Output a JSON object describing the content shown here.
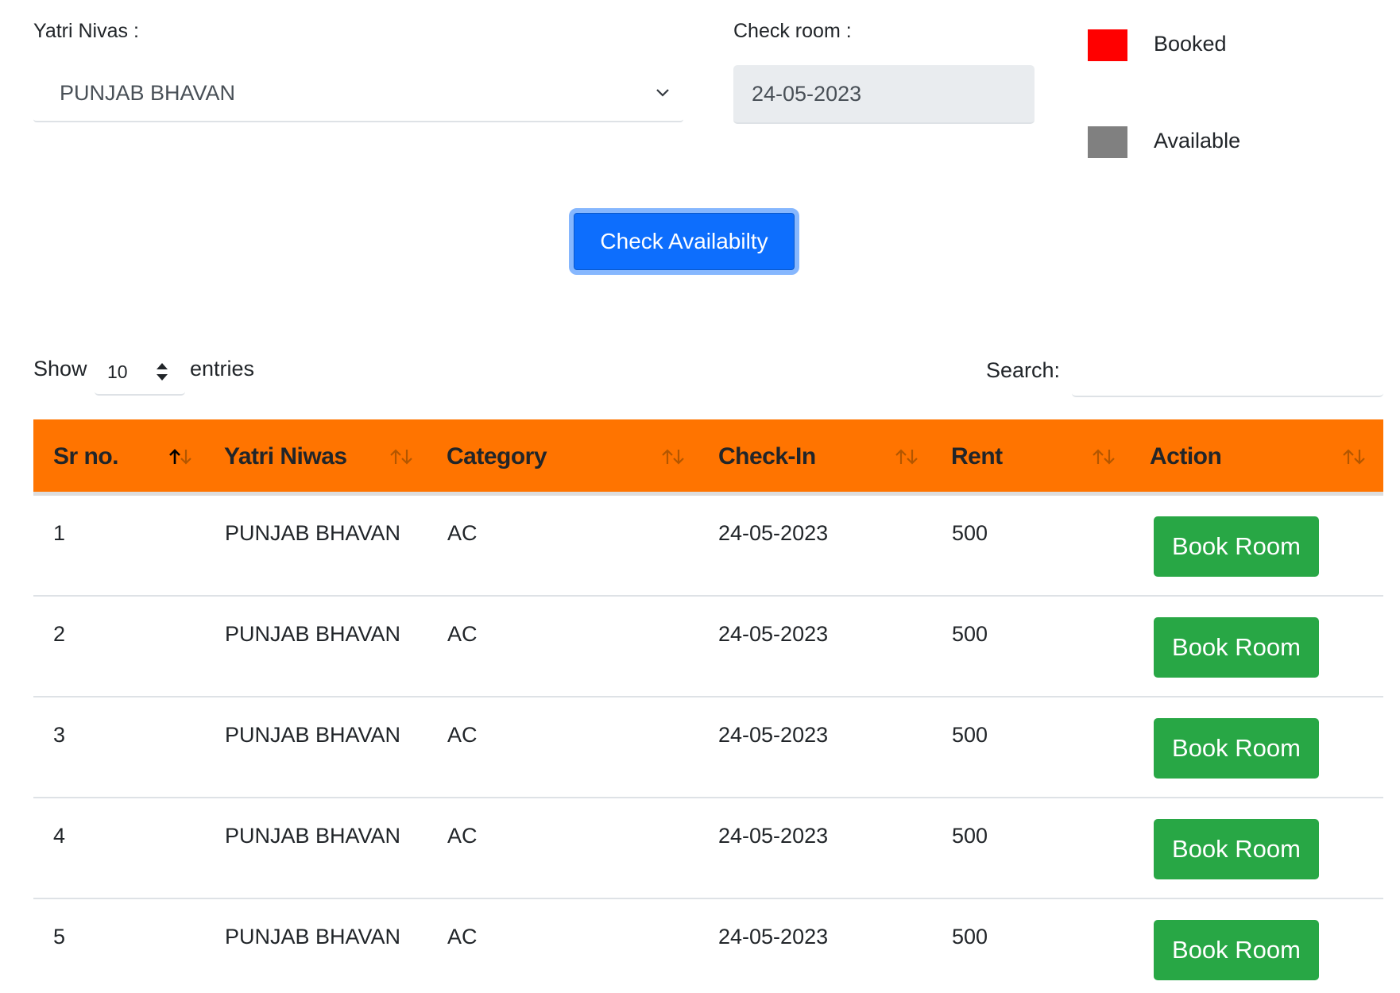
{
  "filters": {
    "yatri_nivas_label": "Yatri Nivas :",
    "yatri_nivas_value": "PUNJAB BHAVAN",
    "check_room_label": "Check room :",
    "check_room_value": "24-05-2023"
  },
  "legend": {
    "booked_label": "Booked",
    "booked_color": "#ff0000",
    "available_label": "Available",
    "available_color": "#808080"
  },
  "check_button_label": "Check Availabilty",
  "table_controls": {
    "show_label": "Show",
    "entries_value": "10",
    "entries_label": "entries",
    "search_label": "Search:",
    "search_value": ""
  },
  "table": {
    "header_color": "#ff7400",
    "columns": [
      "Sr no.",
      "Yatri Niwas",
      "Category",
      "Check-In",
      "Rent",
      "Action"
    ],
    "rows": [
      {
        "sr": "1",
        "niwas": "PUNJAB BHAVAN",
        "category": "AC",
        "checkin": "24-05-2023",
        "rent": "500",
        "action": "Book Room"
      },
      {
        "sr": "2",
        "niwas": "PUNJAB BHAVAN",
        "category": "AC",
        "checkin": "24-05-2023",
        "rent": "500",
        "action": "Book Room"
      },
      {
        "sr": "3",
        "niwas": "PUNJAB BHAVAN",
        "category": "AC",
        "checkin": "24-05-2023",
        "rent": "500",
        "action": "Book Room"
      },
      {
        "sr": "4",
        "niwas": "PUNJAB BHAVAN",
        "category": "AC",
        "checkin": "24-05-2023",
        "rent": "500",
        "action": "Book Room"
      },
      {
        "sr": "5",
        "niwas": "PUNJAB BHAVAN",
        "category": "AC",
        "checkin": "24-05-2023",
        "rent": "500",
        "action": "Book Room"
      }
    ]
  }
}
